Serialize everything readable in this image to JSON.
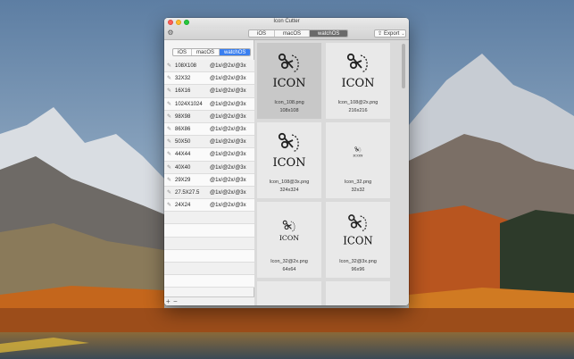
{
  "window": {
    "title": "Icon Cutter"
  },
  "toolbar": {
    "platforms": [
      {
        "label": "iOS",
        "active": false
      },
      {
        "label": "macOS",
        "active": false
      },
      {
        "label": "watchOS",
        "active": true
      }
    ],
    "export_label": "Export"
  },
  "sidebar": {
    "platforms": [
      {
        "label": "iOS",
        "active": false
      },
      {
        "label": "macOS",
        "active": false
      },
      {
        "label": "watchOS",
        "active": true
      }
    ],
    "sizes": [
      {
        "size": "108X108",
        "scales": "@1x/@2x/@3x"
      },
      {
        "size": "32X32",
        "scales": "@1x/@2x/@3x"
      },
      {
        "size": "16X16",
        "scales": "@1x/@2x/@3x"
      },
      {
        "size": "1024X1024",
        "scales": "@1x/@2x/@3x"
      },
      {
        "size": "98X98",
        "scales": "@1x/@2x/@3x"
      },
      {
        "size": "86X86",
        "scales": "@1x/@2x/@3x"
      },
      {
        "size": "50X50",
        "scales": "@1x/@2x/@3x"
      },
      {
        "size": "44X44",
        "scales": "@1x/@2x/@3x"
      },
      {
        "size": "40X40",
        "scales": "@1x/@2x/@3x"
      },
      {
        "size": "29X29",
        "scales": "@1x/@2x/@3x"
      },
      {
        "size": "27.5X27.5",
        "scales": "@1x/@2x/@3x"
      },
      {
        "size": "24X24",
        "scales": "@1x/@2x/@3x"
      }
    ],
    "add_label": "+",
    "remove_label": "−"
  },
  "grid": {
    "icon_text": "ICON",
    "tiles": [
      {
        "filename": "Icon_108.png",
        "dims": "108x108",
        "selected": true,
        "scale": 1.0
      },
      {
        "filename": "Icon_108@2x.png",
        "dims": "216x216",
        "selected": false,
        "scale": 1.0
      },
      {
        "filename": "Icon_108@3x.png",
        "dims": "324x324",
        "selected": false,
        "scale": 1.0
      },
      {
        "filename": "Icon_32.png",
        "dims": "32x32",
        "selected": false,
        "scale": 0.3
      },
      {
        "filename": "Icon_32@2x.png",
        "dims": "64x64",
        "selected": false,
        "scale": 0.6
      },
      {
        "filename": "Icon_32@3x.png",
        "dims": "96x96",
        "selected": false,
        "scale": 0.9
      }
    ]
  }
}
